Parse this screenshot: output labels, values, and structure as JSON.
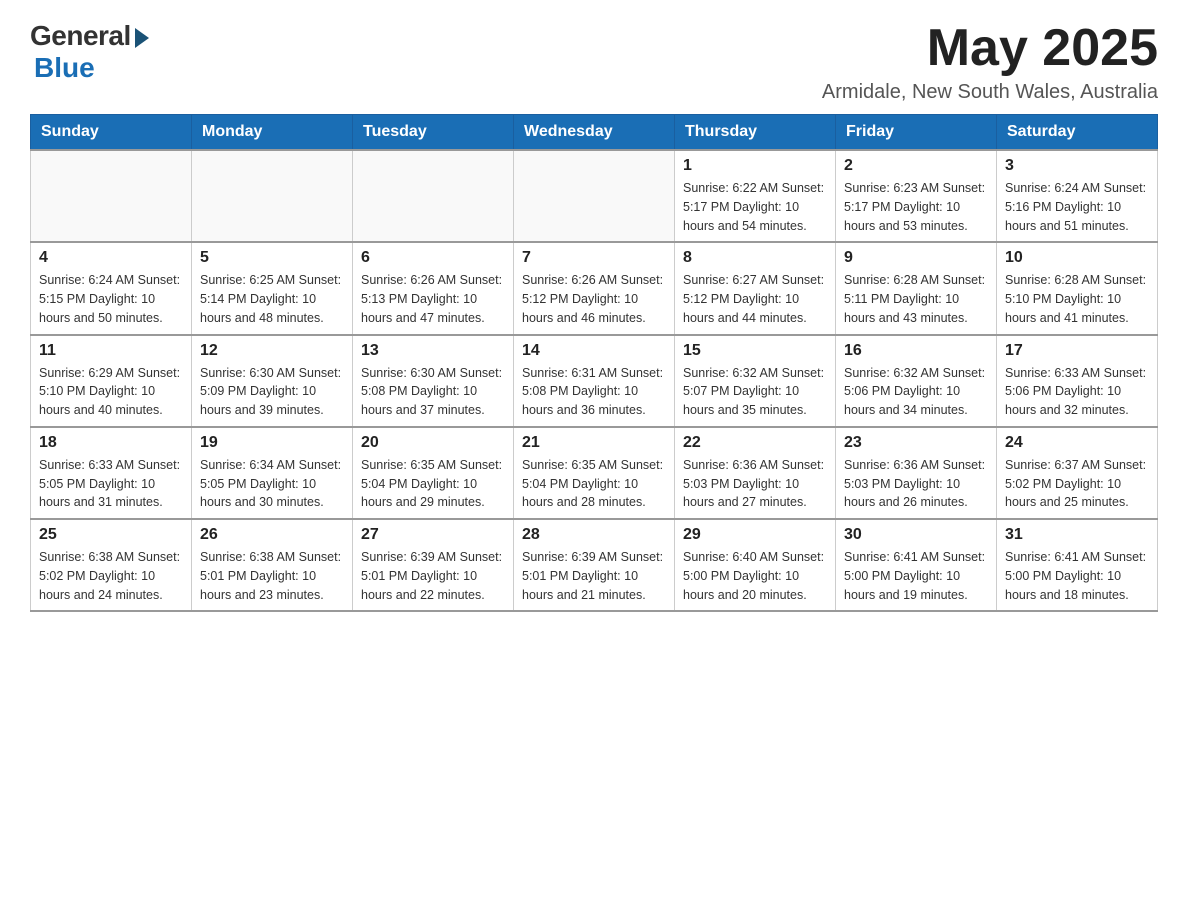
{
  "header": {
    "logo_general": "General",
    "logo_blue": "Blue",
    "month_title": "May 2025",
    "location": "Armidale, New South Wales, Australia"
  },
  "days_of_week": [
    "Sunday",
    "Monday",
    "Tuesday",
    "Wednesday",
    "Thursday",
    "Friday",
    "Saturday"
  ],
  "weeks": [
    [
      {
        "day": "",
        "info": ""
      },
      {
        "day": "",
        "info": ""
      },
      {
        "day": "",
        "info": ""
      },
      {
        "day": "",
        "info": ""
      },
      {
        "day": "1",
        "info": "Sunrise: 6:22 AM\nSunset: 5:17 PM\nDaylight: 10 hours and 54 minutes."
      },
      {
        "day": "2",
        "info": "Sunrise: 6:23 AM\nSunset: 5:17 PM\nDaylight: 10 hours and 53 minutes."
      },
      {
        "day": "3",
        "info": "Sunrise: 6:24 AM\nSunset: 5:16 PM\nDaylight: 10 hours and 51 minutes."
      }
    ],
    [
      {
        "day": "4",
        "info": "Sunrise: 6:24 AM\nSunset: 5:15 PM\nDaylight: 10 hours and 50 minutes."
      },
      {
        "day": "5",
        "info": "Sunrise: 6:25 AM\nSunset: 5:14 PM\nDaylight: 10 hours and 48 minutes."
      },
      {
        "day": "6",
        "info": "Sunrise: 6:26 AM\nSunset: 5:13 PM\nDaylight: 10 hours and 47 minutes."
      },
      {
        "day": "7",
        "info": "Sunrise: 6:26 AM\nSunset: 5:12 PM\nDaylight: 10 hours and 46 minutes."
      },
      {
        "day": "8",
        "info": "Sunrise: 6:27 AM\nSunset: 5:12 PM\nDaylight: 10 hours and 44 minutes."
      },
      {
        "day": "9",
        "info": "Sunrise: 6:28 AM\nSunset: 5:11 PM\nDaylight: 10 hours and 43 minutes."
      },
      {
        "day": "10",
        "info": "Sunrise: 6:28 AM\nSunset: 5:10 PM\nDaylight: 10 hours and 41 minutes."
      }
    ],
    [
      {
        "day": "11",
        "info": "Sunrise: 6:29 AM\nSunset: 5:10 PM\nDaylight: 10 hours and 40 minutes."
      },
      {
        "day": "12",
        "info": "Sunrise: 6:30 AM\nSunset: 5:09 PM\nDaylight: 10 hours and 39 minutes."
      },
      {
        "day": "13",
        "info": "Sunrise: 6:30 AM\nSunset: 5:08 PM\nDaylight: 10 hours and 37 minutes."
      },
      {
        "day": "14",
        "info": "Sunrise: 6:31 AM\nSunset: 5:08 PM\nDaylight: 10 hours and 36 minutes."
      },
      {
        "day": "15",
        "info": "Sunrise: 6:32 AM\nSunset: 5:07 PM\nDaylight: 10 hours and 35 minutes."
      },
      {
        "day": "16",
        "info": "Sunrise: 6:32 AM\nSunset: 5:06 PM\nDaylight: 10 hours and 34 minutes."
      },
      {
        "day": "17",
        "info": "Sunrise: 6:33 AM\nSunset: 5:06 PM\nDaylight: 10 hours and 32 minutes."
      }
    ],
    [
      {
        "day": "18",
        "info": "Sunrise: 6:33 AM\nSunset: 5:05 PM\nDaylight: 10 hours and 31 minutes."
      },
      {
        "day": "19",
        "info": "Sunrise: 6:34 AM\nSunset: 5:05 PM\nDaylight: 10 hours and 30 minutes."
      },
      {
        "day": "20",
        "info": "Sunrise: 6:35 AM\nSunset: 5:04 PM\nDaylight: 10 hours and 29 minutes."
      },
      {
        "day": "21",
        "info": "Sunrise: 6:35 AM\nSunset: 5:04 PM\nDaylight: 10 hours and 28 minutes."
      },
      {
        "day": "22",
        "info": "Sunrise: 6:36 AM\nSunset: 5:03 PM\nDaylight: 10 hours and 27 minutes."
      },
      {
        "day": "23",
        "info": "Sunrise: 6:36 AM\nSunset: 5:03 PM\nDaylight: 10 hours and 26 minutes."
      },
      {
        "day": "24",
        "info": "Sunrise: 6:37 AM\nSunset: 5:02 PM\nDaylight: 10 hours and 25 minutes."
      }
    ],
    [
      {
        "day": "25",
        "info": "Sunrise: 6:38 AM\nSunset: 5:02 PM\nDaylight: 10 hours and 24 minutes."
      },
      {
        "day": "26",
        "info": "Sunrise: 6:38 AM\nSunset: 5:01 PM\nDaylight: 10 hours and 23 minutes."
      },
      {
        "day": "27",
        "info": "Sunrise: 6:39 AM\nSunset: 5:01 PM\nDaylight: 10 hours and 22 minutes."
      },
      {
        "day": "28",
        "info": "Sunrise: 6:39 AM\nSunset: 5:01 PM\nDaylight: 10 hours and 21 minutes."
      },
      {
        "day": "29",
        "info": "Sunrise: 6:40 AM\nSunset: 5:00 PM\nDaylight: 10 hours and 20 minutes."
      },
      {
        "day": "30",
        "info": "Sunrise: 6:41 AM\nSunset: 5:00 PM\nDaylight: 10 hours and 19 minutes."
      },
      {
        "day": "31",
        "info": "Sunrise: 6:41 AM\nSunset: 5:00 PM\nDaylight: 10 hours and 18 minutes."
      }
    ]
  ]
}
